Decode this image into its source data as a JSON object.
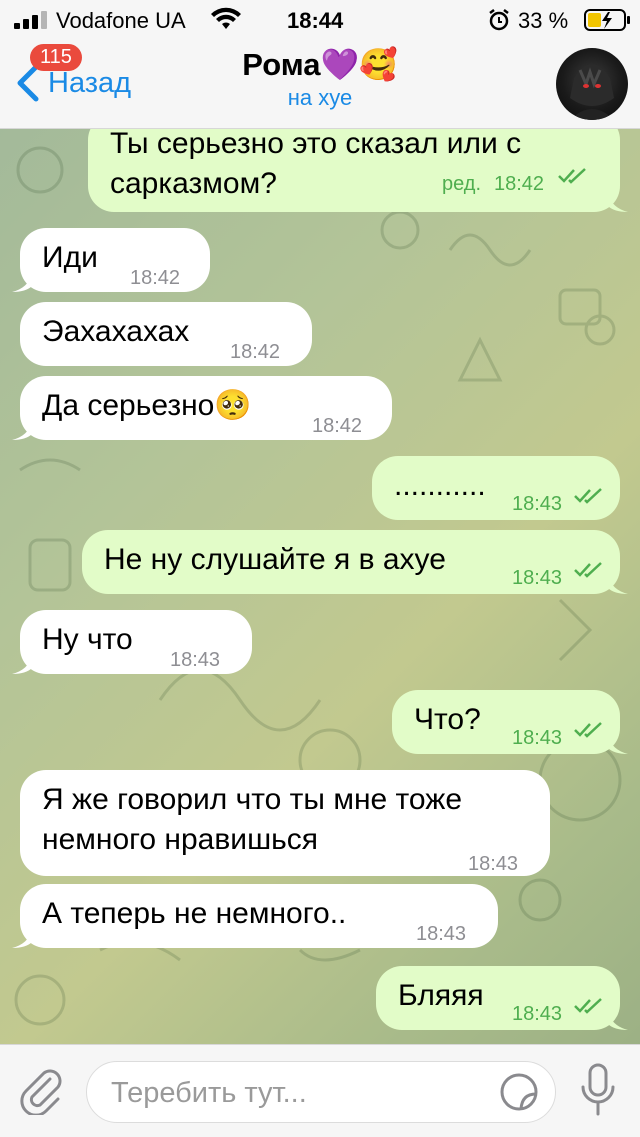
{
  "status_bar": {
    "carrier": "Vodafone UA",
    "time": "18:44",
    "battery_percent": "33 %"
  },
  "header": {
    "back_label": "Назад",
    "unread_badge": "115",
    "title": "Рома💜🥰",
    "subtitle": "на хуе"
  },
  "messages": [
    {
      "side": "out",
      "text_line1": "Ты серьезно это сказал или с",
      "text_line2": "сарказмом?",
      "edited": "ред.",
      "time": "18:42"
    },
    {
      "side": "in",
      "text": "Иди",
      "time": "18:42"
    },
    {
      "side": "in",
      "text": "Эахахахах",
      "time": "18:42"
    },
    {
      "side": "in",
      "text": "Да серьезно🥺",
      "time": "18:42"
    },
    {
      "side": "out",
      "text": "...........",
      "time": "18:43"
    },
    {
      "side": "out",
      "text": "Не ну слушайте я в ахуе",
      "time": "18:43"
    },
    {
      "side": "in",
      "text": "Ну что",
      "time": "18:43"
    },
    {
      "side": "out",
      "text": "Что?",
      "time": "18:43"
    },
    {
      "side": "in",
      "text_line1": "Я же говорил что ты мне тоже",
      "text_line2": "немного нравишься",
      "time": "18:43"
    },
    {
      "side": "in",
      "text": "А теперь не немного..",
      "time": "18:43"
    },
    {
      "side": "out",
      "text": "Бляяя",
      "time": "18:43"
    }
  ],
  "input": {
    "placeholder": "Теребить тут..."
  },
  "colors": {
    "accent": "#1a8ae5",
    "outgoing_bubble": "#e2fcc8",
    "incoming_bubble": "#ffffff",
    "read_ticks": "#4fae4f",
    "badge": "#ea4a3d"
  },
  "icons": [
    "signal-icon",
    "wifi-icon",
    "alarm-icon",
    "battery-icon",
    "back-chevron-icon",
    "avatar",
    "attach-icon",
    "sticker-icon",
    "mic-icon",
    "double-check-icon"
  ]
}
